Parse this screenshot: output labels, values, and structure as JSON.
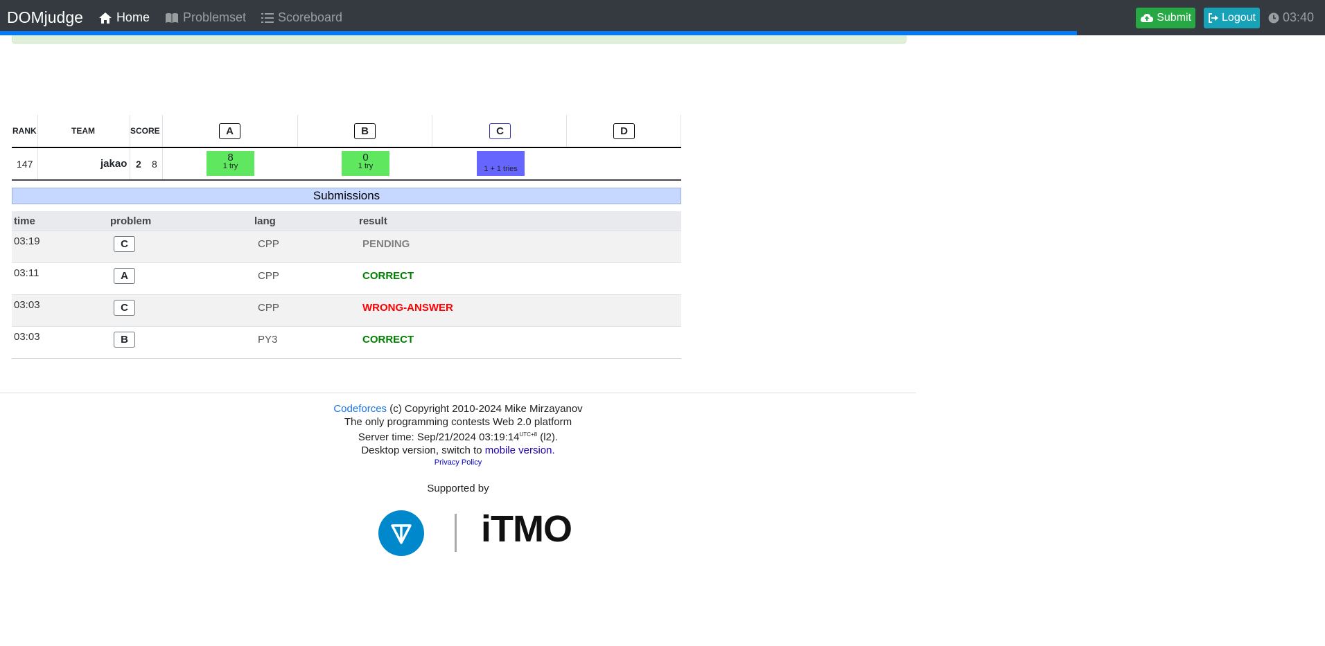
{
  "navbar": {
    "brand": "DOMjudge",
    "home": "Home",
    "problemset": "Problemset",
    "scoreboard": "Scoreboard",
    "submit": "Submit",
    "logout": "Logout",
    "clock": "03:40",
    "contest_progress": 0.813
  },
  "scoreboard": {
    "headers": {
      "rank": "RANK",
      "team": "TEAM",
      "score": "SCORE"
    },
    "problems": [
      "A",
      "B",
      "C",
      "D"
    ],
    "row": {
      "rank": "147",
      "team": "jakao",
      "solved": "2",
      "penalty": "8",
      "cells": [
        {
          "problem": "A",
          "time": "8",
          "tries": "1 try",
          "status": "solved",
          "color": "#60e760"
        },
        {
          "problem": "B",
          "time": "0",
          "tries": "1 try",
          "status": "solved",
          "color": "#60e760"
        },
        {
          "problem": "C",
          "time": "",
          "tries": "1 + 1 tries",
          "status": "pending",
          "color": "#6666ff"
        },
        {
          "problem": "D",
          "time": "",
          "tries": "",
          "status": "none",
          "color": ""
        }
      ]
    }
  },
  "submissions": {
    "title": "Submissions",
    "columns": {
      "time": "time",
      "problem": "problem",
      "lang": "lang",
      "result": "result"
    },
    "rows": [
      {
        "time": "03:19",
        "problem": "C",
        "lang": "CPP",
        "result": "PENDING",
        "color": "#808080"
      },
      {
        "time": "03:11",
        "problem": "A",
        "lang": "CPP",
        "result": "CORRECT",
        "color": "#008000"
      },
      {
        "time": "03:03",
        "problem": "C",
        "lang": "CPP",
        "result": "WRONG-ANSWER",
        "color": "#ff0000"
      },
      {
        "time": "03:03",
        "problem": "B",
        "lang": "PY3",
        "result": "CORRECT",
        "color": "#008000"
      }
    ]
  },
  "footer": {
    "codeforces_link": "Codeforces",
    "copyright": "(c) Copyright 2010-2024 Mike Mirzayanov",
    "tagline": "The only programming contests Web 2.0 platform",
    "server_time_prefix": "Server time: Sep/21/2024 03:19:14",
    "server_tz": "UTC+8",
    "server_suffix": "(l2).",
    "desktop_prefix": "Desktop version, switch to",
    "mobile_link": "mobile version.",
    "privacy": "Privacy Policy",
    "supported_by": "Supported by",
    "itmo_logo": "iTMO"
  },
  "colors": {
    "navbar": "#343a40",
    "submit": "#28a745",
    "logout": "#17a2b8",
    "progress": "#007bff",
    "solved": "#60e760",
    "pending": "#6666ff"
  }
}
